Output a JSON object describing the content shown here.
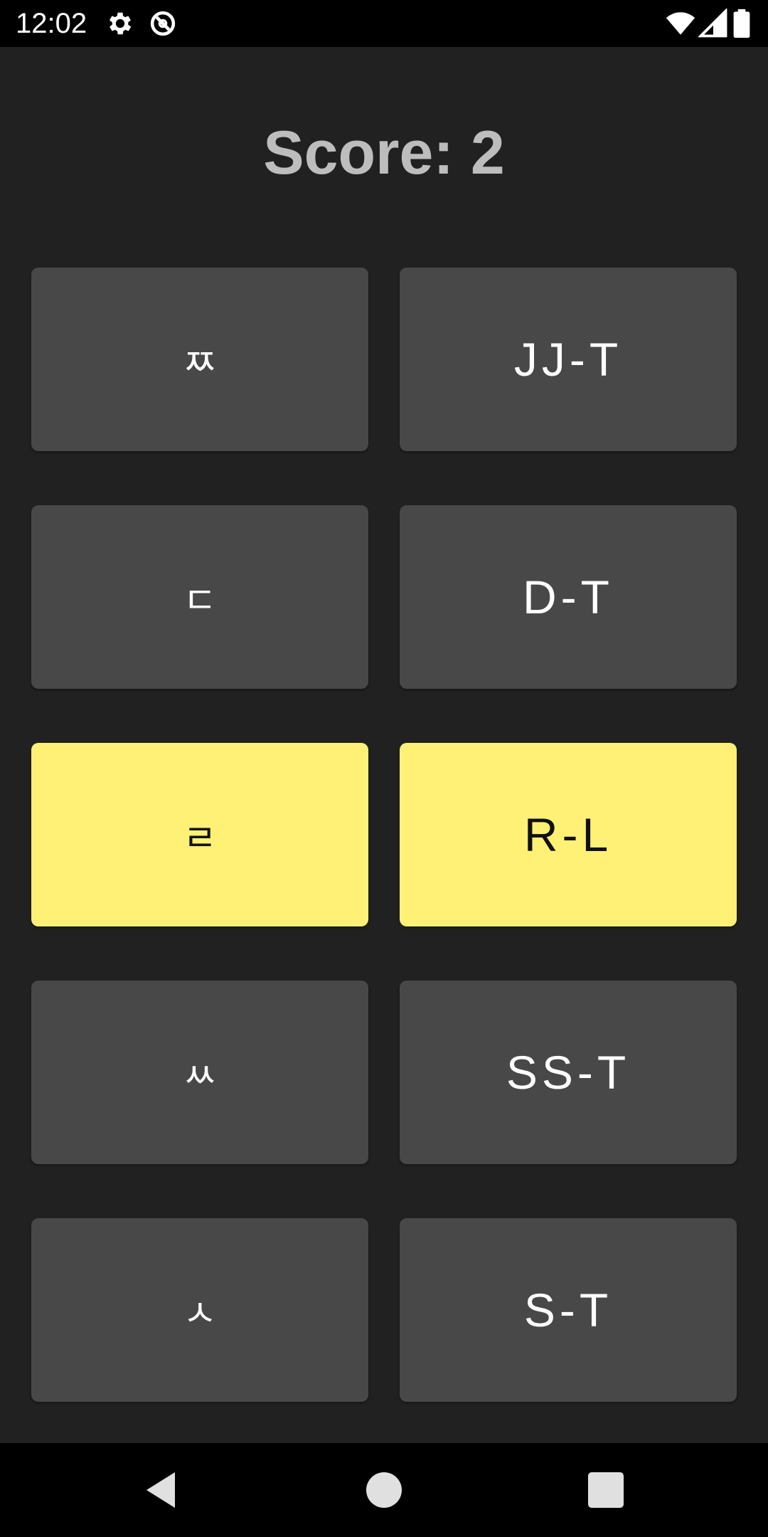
{
  "status_bar": {
    "time": "12:02",
    "icons": [
      "settings-icon",
      "data-saver-icon",
      "wifi-icon",
      "signal-icon",
      "battery-icon"
    ]
  },
  "score": {
    "text": "Score: 2"
  },
  "tiles": [
    {
      "korean": "ㅉ",
      "roman": "JJ-T",
      "selected": false
    },
    {
      "korean": "ㄷ",
      "roman": "D-T",
      "selected": false
    },
    {
      "korean": "ㄹ",
      "roman": "R-L",
      "selected": true
    },
    {
      "korean": "ㅆ",
      "roman": "SS-T",
      "selected": false
    },
    {
      "korean": "ㅅ",
      "roman": "S-T",
      "selected": false
    }
  ],
  "colors": {
    "background": "#212121",
    "tile": "#484848",
    "tile_selected": "#fff176",
    "score_text": "#bdbdbd"
  },
  "nav_bar": {
    "icons": [
      "back-icon",
      "home-icon",
      "recents-icon"
    ]
  }
}
